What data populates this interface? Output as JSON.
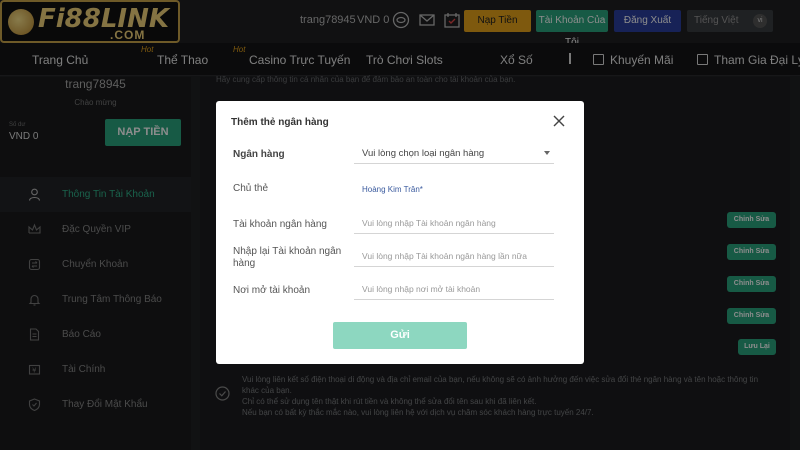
{
  "header": {
    "logo_text": "Fi88LINK",
    "logo_sub": ".COM",
    "username": "trang78945",
    "balance": "VND 0",
    "deposit_label": "Nạp Tiền",
    "account_label": "Tài Khoản Của Tôi",
    "logout_label": "Đăng Xuất",
    "language": "Tiếng Việt",
    "language_code": "vi",
    "icons": [
      "user-circle-icon",
      "mail-icon",
      "calendar-icon"
    ]
  },
  "nav": {
    "items": [
      {
        "label": "Trang Chủ",
        "hot": ""
      },
      {
        "label": "Thể Thao",
        "hot": "Hot"
      },
      {
        "label": "Casino Trực Tuyến",
        "hot": "Hot"
      },
      {
        "label": "Trò Chơi Slots",
        "hot": ""
      },
      {
        "label": "Xổ Số",
        "hot": ""
      },
      {
        "label": "Khuyến Mãi",
        "hot": ""
      },
      {
        "label": "Tham Gia Đại Lý",
        "hot": ""
      }
    ]
  },
  "sidebar": {
    "username": "trang78945",
    "welcome": "Chào mừng",
    "balance_label": "Số dư",
    "balance": "VND 0",
    "deposit_label": "NẠP TIỀN",
    "items": [
      {
        "label": "Thông Tin Tài Khoản",
        "icon": "user-icon"
      },
      {
        "label": "Đặc Quyền VIP",
        "icon": "crown-icon"
      },
      {
        "label": "Chuyển Khoản",
        "icon": "transfer-icon"
      },
      {
        "label": "Trung Tâm Thông Báo",
        "icon": "bell-icon"
      },
      {
        "label": "Báo Cáo",
        "icon": "report-icon"
      },
      {
        "label": "Tài Chính",
        "icon": "wallet-icon"
      },
      {
        "label": "Thay Đổi Mật Khẩu",
        "icon": "shield-icon"
      }
    ]
  },
  "main": {
    "intro": "Hãy cung cấp thông tin cá nhân của bạn để đảm bảo an toàn cho tài khoản của bạn.",
    "edit_label": "Chỉnh Sửa",
    "save_label": "Lưu Lại",
    "notes": [
      "Vui lòng liên kết số điện thoại di động và địa chỉ email của bạn, nếu không sẽ có ảnh hưởng đến việc sửa đổi thẻ ngân hàng và tên hoặc thông tin khác của bạn.",
      "Chỉ có thể sử dụng tên thật khi rút tiền và không thể sửa đổi tên sau khi đã liên kết.",
      "Nếu bạn có bất kỳ thắc mắc nào, vui lòng liên hệ với dịch vụ chăm sóc khách hàng trực tuyến 24/7."
    ]
  },
  "modal": {
    "title": "Thêm thẻ ngân hàng",
    "fields": {
      "bank": {
        "label": "Ngân hàng",
        "value": "Vui lòng chọn loại ngân hàng"
      },
      "holder": {
        "label": "Chủ thẻ",
        "value": "Hoàng Kim Trân*"
      },
      "account": {
        "label": "Tài khoản ngân hàng",
        "placeholder": "Vui lòng nhập Tài khoản ngân hàng"
      },
      "account_confirm": {
        "label": "Nhập lại Tài khoản ngân hàng",
        "placeholder": "Vui lòng nhập Tài khoản ngân hàng lần nữa"
      },
      "branch": {
        "label": "Nơi mở tài khoản",
        "placeholder": "Vui lòng nhập nơi mở tài khoản"
      }
    },
    "submit_label": "Gửi"
  },
  "colors": {
    "accent_green": "#2aa57f",
    "accent_orange": "#e6a21a",
    "accent_blue": "#2b3e9f",
    "logo_gold": "#f3d47a"
  }
}
